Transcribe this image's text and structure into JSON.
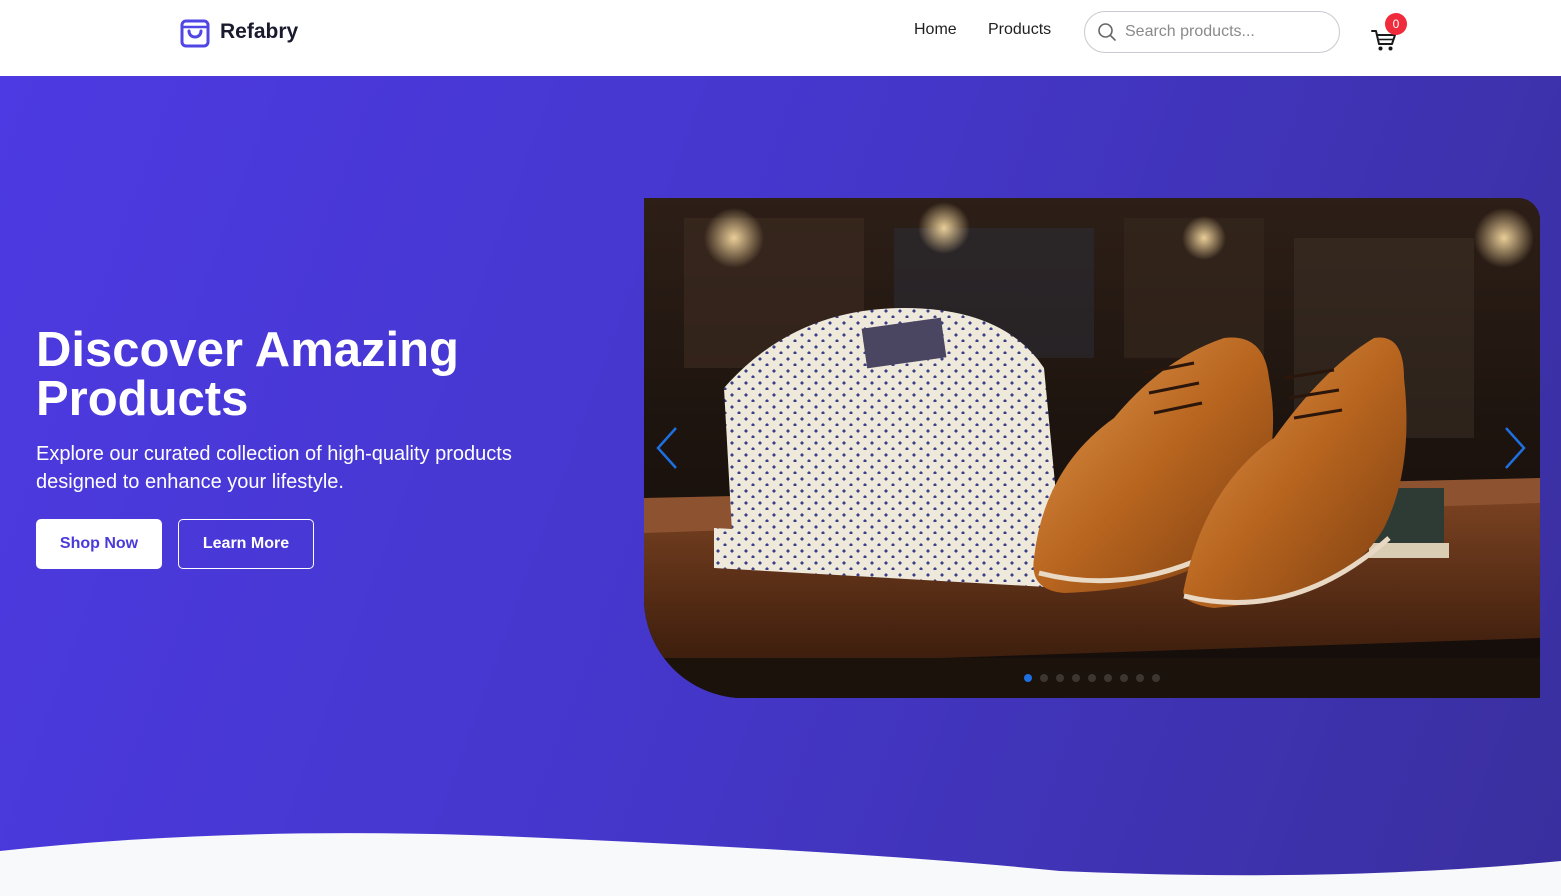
{
  "brand": {
    "name": "Refabry",
    "icon": "shopping-bag-icon",
    "accent": "#4f46e5"
  },
  "nav": {
    "items": [
      {
        "label": "Home"
      },
      {
        "label": "Products"
      }
    ]
  },
  "search": {
    "placeholder": "Search products...",
    "value": "",
    "icon": "search-icon"
  },
  "cart": {
    "icon": "cart-icon",
    "count": "0",
    "badge_color": "#ef2b3c"
  },
  "hero": {
    "title": "Discover Amazing Products",
    "subtitle": "Explore our curated collection of high-quality products designed to enhance your lifestyle.",
    "primary_button": "Shop Now",
    "secondary_button": "Learn More",
    "gradient_start": "#4d3ae2",
    "gradient_end": "#3a2f9e"
  },
  "carousel": {
    "slide_count": 9,
    "active_index": 0,
    "prev_icon": "chevron-left-icon",
    "next_icon": "chevron-right-icon",
    "active_dot_color": "#1e6fe0"
  }
}
